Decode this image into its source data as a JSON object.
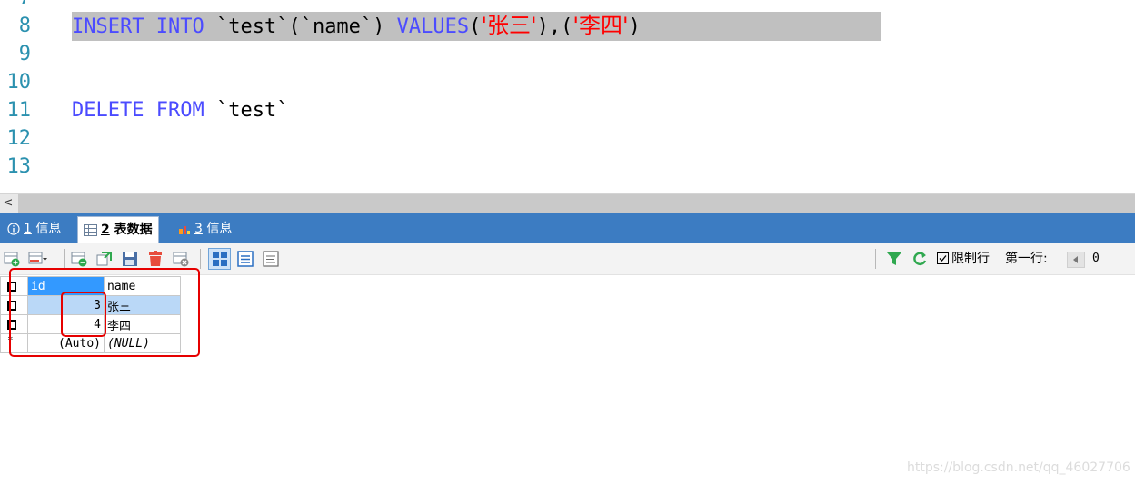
{
  "editor": {
    "partial_line_number": "7",
    "lines": [
      {
        "num": "8",
        "kw1": "INSERT",
        "kw2": "INTO",
        "table": "`test`",
        "col": "(`name`)",
        "kw3": "VALUES",
        "p1": "(",
        "s1": "'张三'",
        "mid": "),(",
        "s2": "'李四'",
        "p2": ")"
      },
      {
        "num": "9"
      },
      {
        "num": "10"
      },
      {
        "num": "11",
        "kw1": "DELETE",
        "kw2": "FROM",
        "table": "`test`"
      },
      {
        "num": "12"
      },
      {
        "num": "13"
      }
    ]
  },
  "scrollbar": {
    "left_arrow": "<"
  },
  "tabs": [
    {
      "icon": "info-icon",
      "num": "1",
      "label": "信息"
    },
    {
      "icon": "table-icon",
      "num": "2",
      "label": "表数据",
      "active": true
    },
    {
      "icon": "chart-icon",
      "num": "3",
      "label": "信息"
    }
  ],
  "toolbar": {
    "limit_label": "限制行",
    "first_row_label": "第一行:",
    "first_row_value": "0"
  },
  "grid": {
    "columns": [
      "id",
      "name"
    ],
    "rows": [
      {
        "id": "3",
        "name": "张三"
      },
      {
        "id": "4",
        "name": "李四"
      }
    ],
    "new_row": {
      "marker": "*",
      "id": "(Auto)",
      "name": "(NULL)"
    }
  },
  "colors": {
    "accent": "#3c7cc2",
    "annotation": "#e60000",
    "keyword": "#4b4bff",
    "string": "#ff0000"
  },
  "watermark": "https://blog.csdn.net/qq_46027706"
}
